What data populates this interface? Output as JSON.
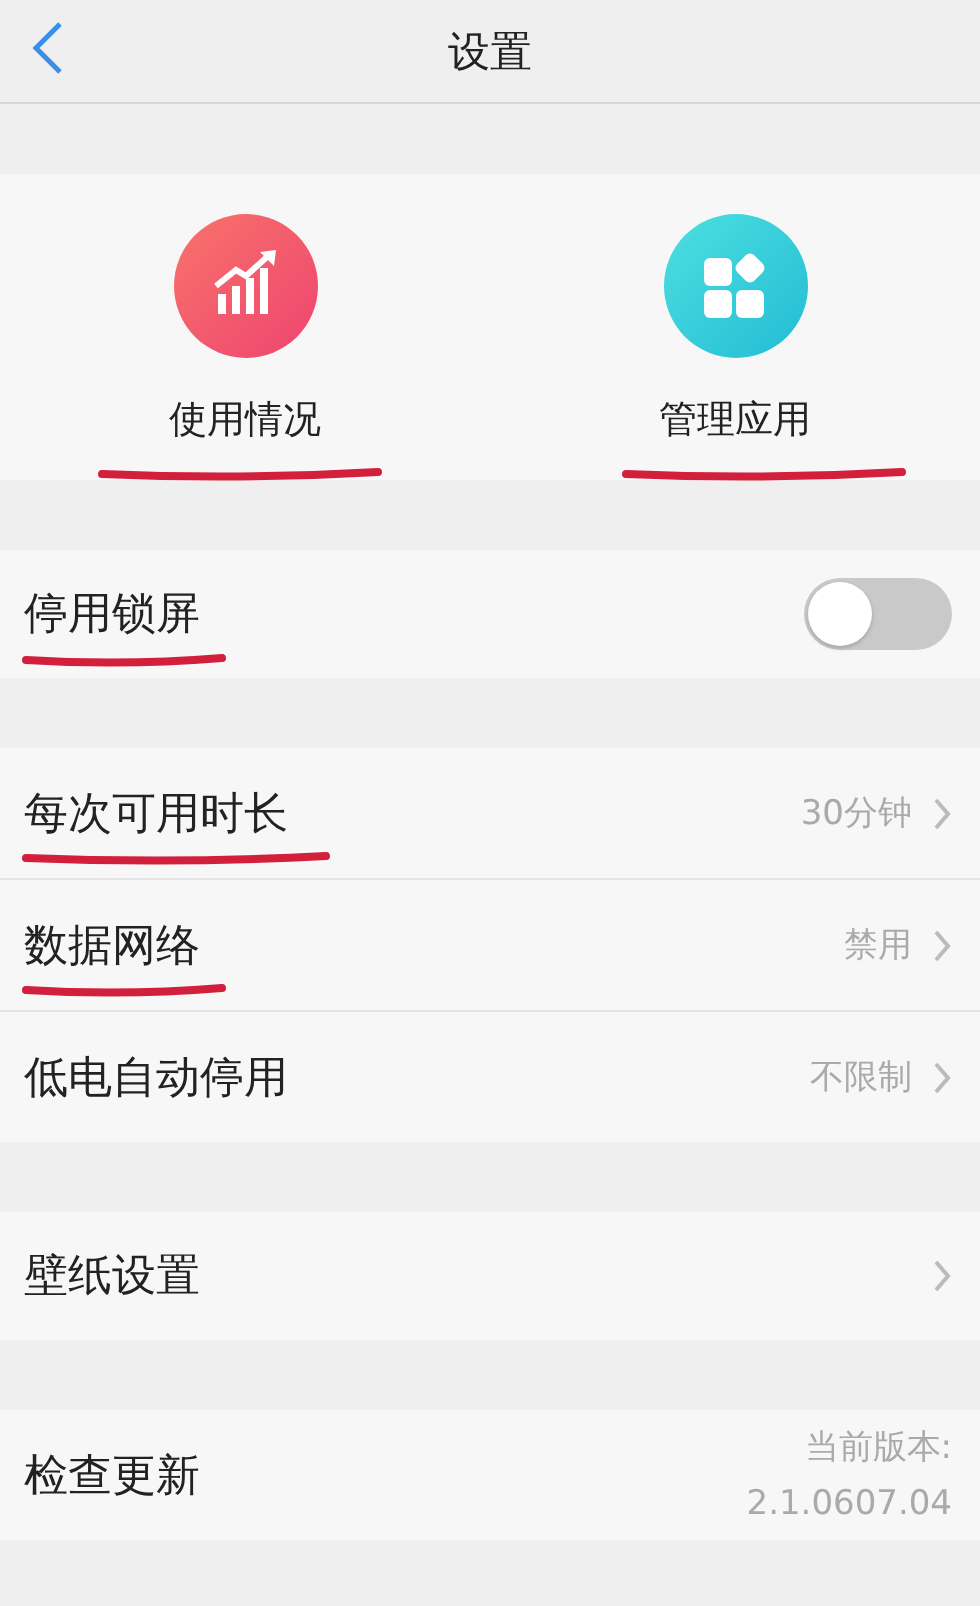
{
  "header": {
    "title": "设置"
  },
  "shortcuts": [
    {
      "label": "使用情况",
      "underlined": true
    },
    {
      "label": "管理应用",
      "underlined": true
    }
  ],
  "groups": [
    [
      {
        "kind": "toggle",
        "label": "停用锁屏",
        "on": false,
        "underlined": true
      }
    ],
    [
      {
        "kind": "value",
        "label": "每次可用时长",
        "value": "30分钟",
        "underlined": true
      },
      {
        "kind": "value",
        "label": "数据网络",
        "value": "禁用",
        "underlined": true
      },
      {
        "kind": "value",
        "label": "低电自动停用",
        "value": "不限制",
        "underlined": false
      }
    ],
    [
      {
        "kind": "link",
        "label": "壁纸设置",
        "underlined": false
      }
    ],
    [
      {
        "kind": "version",
        "label": "检查更新",
        "value_lines": [
          "当前版本:",
          "2.1.0607.04"
        ],
        "underlined": false
      }
    ]
  ]
}
